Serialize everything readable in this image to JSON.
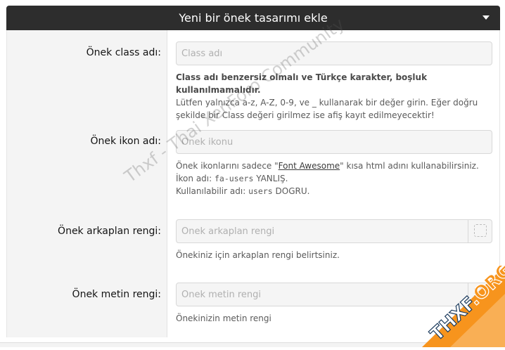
{
  "header": {
    "title": "Yeni bir önek tasarımı ekle",
    "toggle_icon": "caret-down-icon"
  },
  "fields": {
    "class": {
      "label": "Önek class adı:",
      "placeholder": "Class adı",
      "value": "",
      "hint_bold": "Class adı benzersiz olmalı ve Türkçe karakter, boşluk kullanılmamalıdır.",
      "hint": "Lütfen yalnızca a-z, A-Z, 0-9, ve _ kullanarak bir değer girin. Eğer doğru şekilde bir Class değeri girilmez ise afiş kayıt edilmeyecektir!"
    },
    "icon": {
      "label": "Önek ikon adı:",
      "placeholder": "Önek ikonu",
      "value": "",
      "hint_prefix": "Önek ikonlarını sadece \"",
      "hint_link": "Font Awesome",
      "hint_suffix": "\" kısa html adını kullanabilirsiniz.",
      "wrong_prefix": "İkon adı: ",
      "wrong_code": "fa-users",
      "wrong_suffix": " YANLIŞ.",
      "right_prefix": "Kullanılabilir adı: ",
      "right_code": "users",
      "right_suffix": " DOGRU."
    },
    "bg_color": {
      "label": "Önek arkaplan rengi:",
      "placeholder": "Önek arkaplan rengi",
      "value": "",
      "hint": "Önekiniz için arkaplan rengi belirtsiniz."
    },
    "text_color": {
      "label": "Önek metin rengi:",
      "placeholder": "Önek metin rengi",
      "value": "",
      "hint": "Önekinizin metin rengi"
    }
  },
  "watermark": "Thxf - Thai XenForo Community",
  "logo": {
    "text_main": "THXF",
    "text_dot": ".ORG",
    "colors": {
      "orange": "#f7941d",
      "navy": "#1b3a5c",
      "white": "#ffffff"
    }
  },
  "colors": {
    "header_bg": "#2d2d2d",
    "label_col_bg": "#f4f4f4",
    "input_bg": "#f5f5f5"
  }
}
